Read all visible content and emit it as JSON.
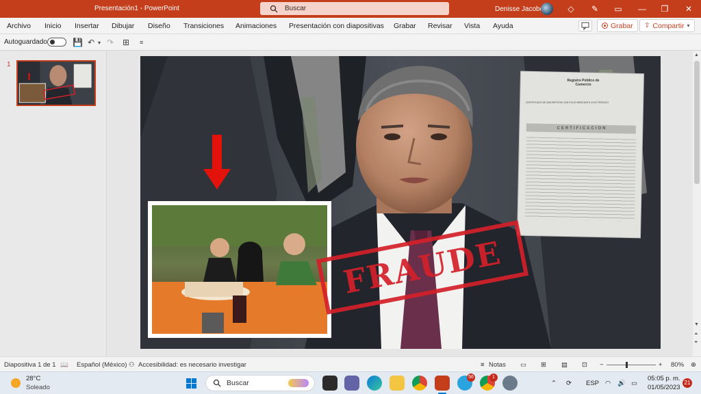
{
  "window": {
    "title": "Presentación1  -  PowerPoint",
    "search_placeholder": "Buscar",
    "user_name": "Denisse Jacobo"
  },
  "ribbon": {
    "tabs": [
      "Archivo",
      "Inicio",
      "Insertar",
      "Dibujar",
      "Diseño",
      "Transiciones",
      "Animaciones",
      "Presentación con diapositivas",
      "Grabar",
      "Revisar",
      "Vista",
      "Ayuda"
    ],
    "record_label": "Grabar",
    "share_label": "Compartir"
  },
  "qat": {
    "autosave_label": "Autoguardado"
  },
  "thumbnails": {
    "slide_number": "1"
  },
  "slide": {
    "stamp_text": "FRAUDE",
    "document_title": "Registro Público de Comercio",
    "document_subtitle": "CERTIFICADO DE INSCRIPCIÓN CON FOLIO MERCANTIL ELECTRÓNICO",
    "document_banner": "CERTIFICACION"
  },
  "status": {
    "slide_info": "Diapositiva 1 de 1",
    "language": "Español (México)",
    "accessibility": "Accesibilidad: es necesario investigar",
    "notes": "Notas",
    "zoom": "80%"
  },
  "taskbar": {
    "temperature": "28°C",
    "weather": "Soleado",
    "search_label": "Buscar",
    "telegram_badge": "56",
    "chrome_badge": "1",
    "language": "ESP",
    "time": "05:05 p. m.",
    "date": "01/05/2023",
    "notifications": "21"
  },
  "colors": {
    "accent": "#c43e1c",
    "stamp_red": "#d4202a",
    "arrow_red": "#e3120b"
  }
}
